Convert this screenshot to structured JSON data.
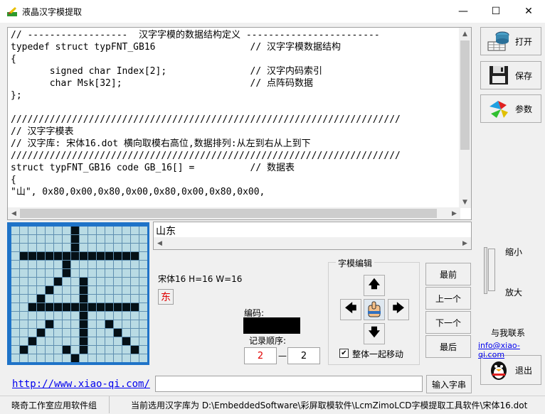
{
  "window": {
    "title": "液晶汉字模提取",
    "minimize": "—",
    "maximize": "☐",
    "close": "✕"
  },
  "editor": {
    "lines": [
      "// ------------------  汉字字模的数据结构定义 ------------------------",
      "typedef struct typFNT_GB16                 // 汉字字模数据结构",
      "{",
      "       signed char Index[2];               // 汉字内码索引",
      "       char Msk[32];                       // 点阵码数据",
      "};",
      "",
      "//////////////////////////////////////////////////////////////////////",
      "// 汉字字模表",
      "// 汉字库: 宋体16.dot 横向取模右高位,数据排列:从左到右从上到下",
      "//////////////////////////////////////////////////////////////////////",
      "struct typFNT_GB16 code GB_16[] =          // 数据表",
      "{",
      "\"山\", 0x80,0x00,0x80,0x00,0x80,0x00,0x80,0x00,"
    ]
  },
  "toolbar": {
    "open": "打开",
    "save": "保存",
    "params": "参数",
    "exit": "退出"
  },
  "input_text": "山东",
  "font_info": "宋体16 H=16 W=16",
  "char_preview": "东",
  "code_label": "编码:",
  "order_label": "记录顺序:",
  "order": {
    "current": "2",
    "dash": "—",
    "total": "2"
  },
  "edit": {
    "title": "字模编辑",
    "up": "🡅",
    "down": "🡇",
    "left": "🡄",
    "right": "🡆",
    "move_together_checked": true,
    "move_together": "整体一起移动"
  },
  "nav": {
    "first": "最前",
    "prev": "上一个",
    "next": "下一个",
    "last": "最后"
  },
  "zoom": {
    "in": "缩小",
    "out": "放大"
  },
  "contact": {
    "label": "与我联系",
    "email": "info@xiao-qi.com"
  },
  "website": "http://www.xiao-qi.com/",
  "input_button": "输入字串",
  "status": {
    "left": "晓奇工作室应用软件组",
    "right": "当前选用汉字库为 D:\\EmbeddedSoftware\\彩屏取模软件\\LcmZimoLCD字模提取工具软件\\宋体16.dot"
  },
  "glyph_rows": [
    "0000000100000000",
    "0000000100000000",
    "0000000100000000",
    "0111111111111110",
    "0000001000000000",
    "0000001000000000",
    "0000010010000000",
    "0000100010000000",
    "0001000010000000",
    "0011111111111110",
    "0000000010000000",
    "0000100010010000",
    "0001000010001000",
    "0010000010000100",
    "0100001010000010",
    "0000000100000000"
  ],
  "colors": {
    "grid_frame": "#1f73c8",
    "pixel_on": "#051016",
    "pixel_off": "#b9dbe4",
    "link": "#0000ee"
  }
}
